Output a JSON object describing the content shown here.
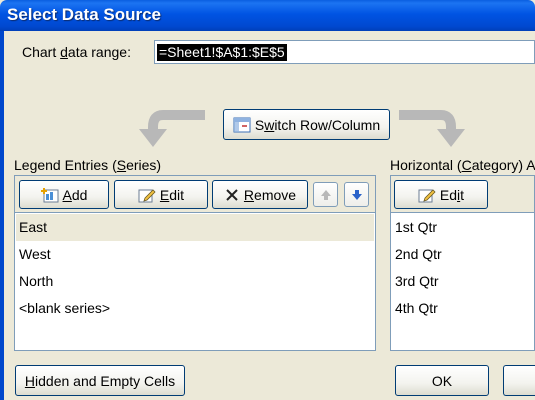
{
  "window": {
    "title": "Select Data Source"
  },
  "chart_range": {
    "label_pre": "Chart ",
    "label_key": "d",
    "label_post": "ata range:",
    "value": "=Sheet1!$A$1:$E$5"
  },
  "switch_button": {
    "key": "w",
    "pre": "S",
    "post": "itch Row/Column"
  },
  "legend": {
    "heading_pre": "Legend Entries (",
    "heading_key": "S",
    "heading_post": "eries)",
    "add_key": "A",
    "add_post": "dd",
    "edit_key": "E",
    "edit_post": "dit",
    "remove_key": "R",
    "remove_post": "emove",
    "items": [
      "East",
      "West",
      "North",
      "<blank series>"
    ],
    "selected_index": 0
  },
  "category": {
    "heading_pre": "Horizontal (",
    "heading_key": "C",
    "heading_post": "ategory) A",
    "edit_pre": "Ed",
    "edit_key": "i",
    "edit_post": "t",
    "items": [
      "1st Qtr",
      "2nd Qtr",
      "3rd Qtr",
      "4th Qtr"
    ]
  },
  "footer": {
    "hidden_key": "H",
    "hidden_post": "idden and Empty Cells",
    "ok": "OK"
  },
  "colors": {
    "titlebar": "#0054e3",
    "dialog_bg": "#ece9d8",
    "selection_bg": "#000000",
    "arrow_blue": "#2a62c9"
  },
  "icons": {
    "add": "add-series-icon",
    "edit": "edit-pencil-icon",
    "remove": "remove-x-icon",
    "move_up": "arrow-up-icon",
    "move_down": "arrow-down-icon",
    "switch": "switch-row-column-icon"
  }
}
